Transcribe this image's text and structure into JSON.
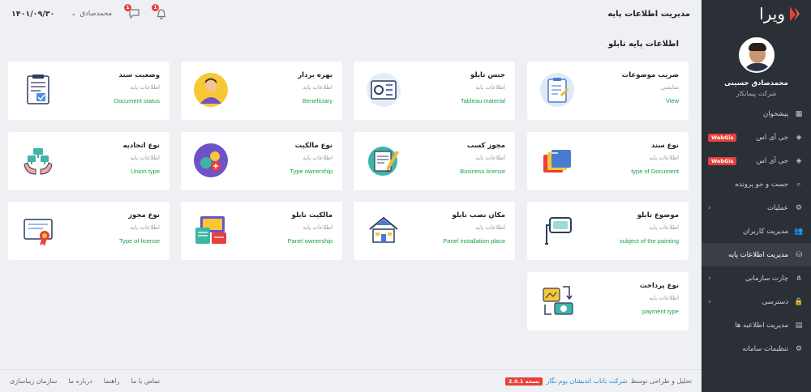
{
  "brand": {
    "name": "ویرا"
  },
  "profile": {
    "name": "محمدصادق حسینی",
    "org": "شرکت پیمانکار"
  },
  "topbar": {
    "page_title": "مدیریت اطلاعات پایه",
    "date": "۱۴۰۱/۰۹/۳۰",
    "user_name": "محمدصادق",
    "notif_count": "1",
    "messages_count": "1"
  },
  "section_title": "اطلاعات پایه تابلو",
  "menu": [
    {
      "label": "پیشخوان",
      "icon": "▦",
      "badge": "",
      "chevron": false,
      "active": false
    },
    {
      "label": "جی آی اس",
      "icon": "◈",
      "badge": "WebGis",
      "chevron": false,
      "active": false
    },
    {
      "label": "جی آی اس",
      "icon": "◈",
      "badge": "WebGis",
      "chevron": false,
      "active": false
    },
    {
      "label": "جست و جو پرونده",
      "icon": "⌕",
      "badge": "",
      "chevron": false,
      "active": false
    },
    {
      "label": "عملیات",
      "icon": "⚙",
      "badge": "",
      "chevron": true,
      "active": false
    },
    {
      "label": "مدیریت کاربران",
      "icon": "👥",
      "badge": "",
      "chevron": false,
      "active": false
    },
    {
      "label": "مدیریت اطلاعات پایه",
      "icon": "⛁",
      "badge": "",
      "chevron": false,
      "active": true
    },
    {
      "label": "چارت سازمانی",
      "icon": "⋔",
      "badge": "",
      "chevron": true,
      "active": false
    },
    {
      "label": "دسترسی",
      "icon": "🔒",
      "badge": "",
      "chevron": true,
      "active": false
    },
    {
      "label": "مدیریت اطلاعیه ها",
      "icon": "▤",
      "badge": "",
      "chevron": false,
      "active": false
    },
    {
      "label": "تنظیمات سامانه",
      "icon": "⚙",
      "badge": "",
      "chevron": false,
      "active": false
    }
  ],
  "cards": [
    {
      "title": "ضریب موضوعات",
      "sub": "نمایشی",
      "link": "View",
      "icon": "clipboard-checklist-icon"
    },
    {
      "title": "جنس تابلو",
      "sub": "اطلاعات پایه",
      "link": "Tableau material",
      "icon": "settings-panel-icon"
    },
    {
      "title": "بهره بردار",
      "sub": "اطلاعات پایه",
      "link": "Beneficiary",
      "icon": "user-avatar-icon"
    },
    {
      "title": "وضعیت سند",
      "sub": "اطلاعات پایه",
      "link": "Document status",
      "icon": "document-status-icon"
    },
    {
      "title": "نوع سند",
      "sub": "اطلاعات پایه",
      "link": "type of Document",
      "icon": "folders-icon"
    },
    {
      "title": "مجوز کسب",
      "sub": "اطلاعات پایه",
      "link": "Business license",
      "icon": "license-pen-icon"
    },
    {
      "title": "نوع مالکیت",
      "sub": "اطلاعات پایه",
      "link": "Type ownership",
      "icon": "ownership-chart-icon"
    },
    {
      "title": "نوع اتحادیه",
      "sub": "اطلاعات پایه",
      "link": "Union type",
      "icon": "union-hands-icon"
    },
    {
      "title": "موضوع تابلو",
      "sub": "اطلاعات پایه",
      "link": "subject of the painting",
      "icon": "signboard-icon"
    },
    {
      "title": "مکان نصب تابلو",
      "sub": "اطلاعات پایه",
      "link": "Panel installation place",
      "icon": "solar-house-icon"
    },
    {
      "title": "مالکیت تابلو",
      "sub": "اطلاعات پایه",
      "link": "Panel ownership",
      "icon": "panel-ownership-icon"
    },
    {
      "title": "نوع مجوز",
      "sub": "اطلاعات پایه",
      "link": "Type of license",
      "icon": "certificate-icon"
    },
    {
      "title": "نوع پرداخت",
      "sub": "اطلاعات پایه",
      "link": "payment type",
      "icon": "payment-exchange-icon"
    }
  ],
  "footer": {
    "links": [
      "تماس با ما",
      "راهنما",
      "درباره ما",
      "سازمان زیباسازی"
    ],
    "credit_prefix": "تحلیل و طراحی توسط",
    "credit_brand": "شرکت باتاب اندیشان بوم نگار",
    "version": "نسخه 2.9.1"
  },
  "colors": {
    "sidebar": "#2b2f36",
    "accent_green": "#17a34a",
    "badge_red": "#e8403a",
    "link_blue": "#2e8bd6"
  }
}
